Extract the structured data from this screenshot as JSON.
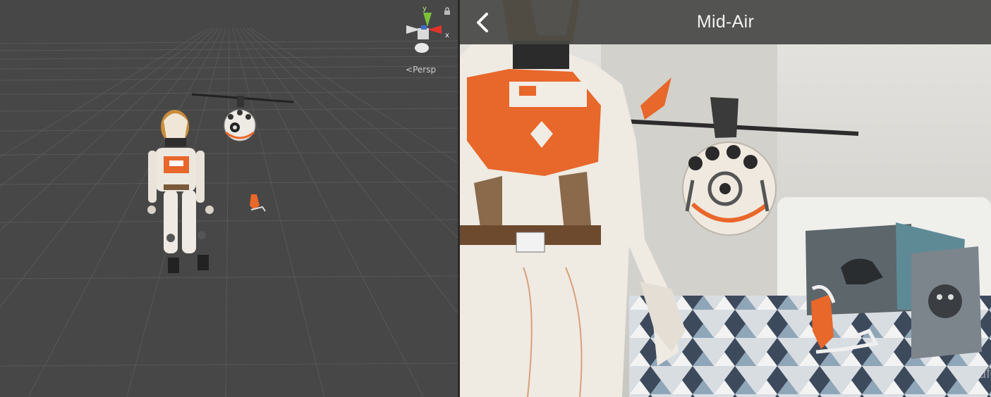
{
  "scene": {
    "gizmo_y_label": "y",
    "gizmo_x_label": "x",
    "projection_label": "Persp",
    "colors": {
      "background": "#474747",
      "grid": "#5a5a5a",
      "axis_y": "#7cc13a",
      "axis_x": "#e0332b"
    }
  },
  "ar": {
    "title": "Mid-Air",
    "back_icon": "chevron-left-icon",
    "watermark": "ufc",
    "colors": {
      "topbar": "#464644",
      "accent": "#e8672a"
    }
  }
}
